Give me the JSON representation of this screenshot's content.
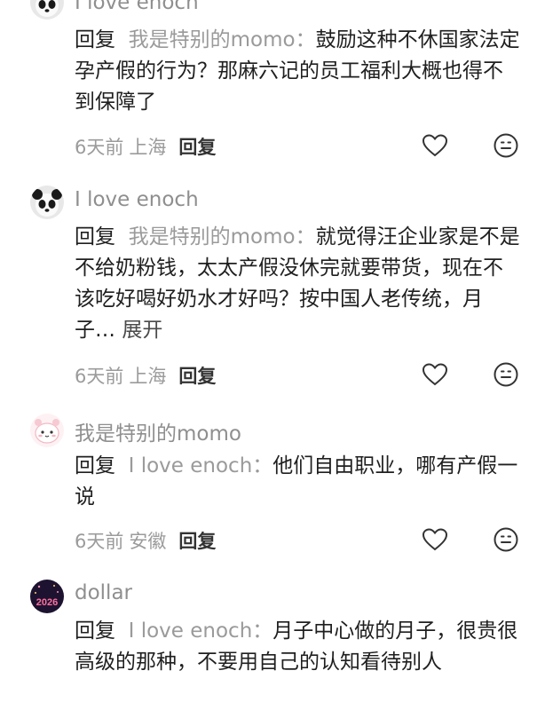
{
  "comments": [
    {
      "username": "I love enoch",
      "reply_label": "回复",
      "target": "我是特别的momo：",
      "text": "鼓励这种不休国家法定孕产假的行为？那麻六记的员工福利大概也得不到保障了",
      "expand": "",
      "time": "6天前",
      "location": "上海",
      "reply_button": "回复"
    },
    {
      "username": "I love enoch",
      "reply_label": "回复",
      "target": "我是特别的momo：",
      "text": "就觉得汪企业家是不是不给奶粉钱，太太产假没休完就要带货，现在不该吃好喝好奶水才好吗？按中国人老传统，月子…",
      "expand": "展开",
      "time": "6天前",
      "location": "上海",
      "reply_button": "回复"
    },
    {
      "username": "我是特别的momo",
      "reply_label": "回复",
      "target": "I love enoch：",
      "text": "他们自由职业，哪有产假一说",
      "expand": "",
      "time": "6天前",
      "location": "安徽",
      "reply_button": "回复"
    },
    {
      "username": "dollar",
      "reply_label": "回复",
      "target": "I love enoch：",
      "text": "月子中心做的月子，很贵很高级的那种，不要用自己的认知看待别人",
      "expand": "",
      "time": "",
      "location": "",
      "reply_button": ""
    }
  ],
  "avatars": [
    "panda-avatar",
    "panda-avatar",
    "pink-character-avatar",
    "dollar-2026-avatar"
  ],
  "avatar_text": {
    "dollar": "2026"
  },
  "icons": [
    "heart-icon",
    "emoji-icon"
  ],
  "colors": {
    "text": "#1f1f1f",
    "muted": "#9a9a9a",
    "background": "#ffffff"
  }
}
